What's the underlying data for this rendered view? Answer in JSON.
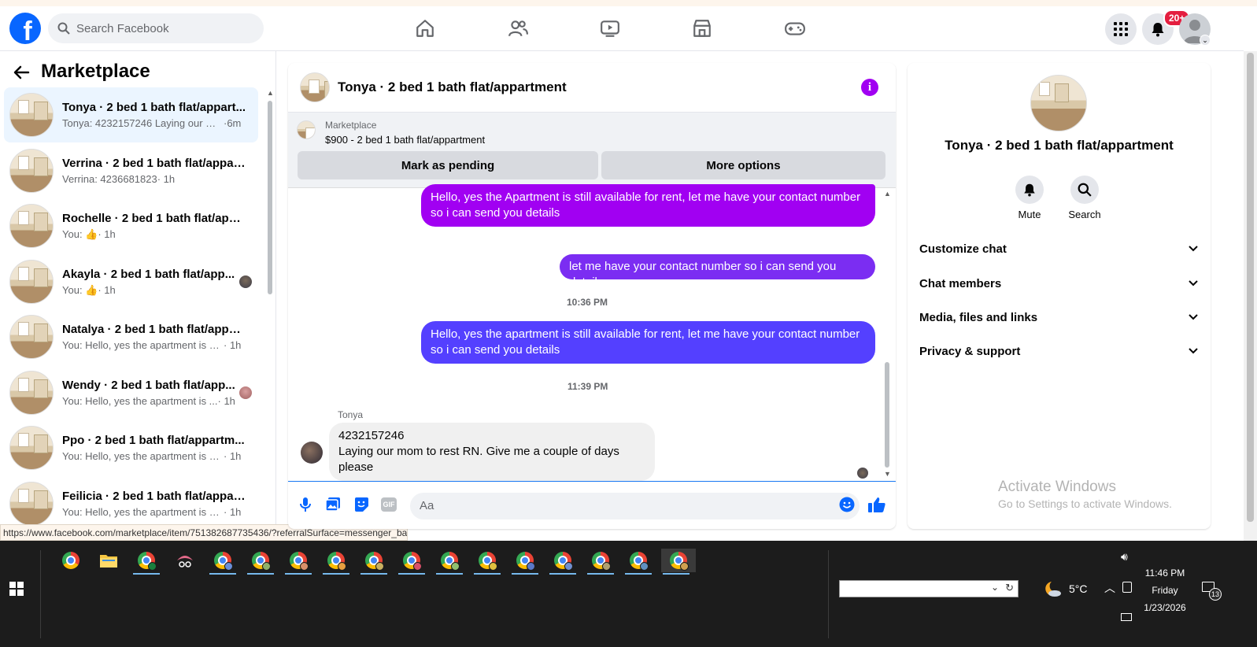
{
  "topbar": {
    "search_placeholder": "Search Facebook",
    "notifications_badge": "20+",
    "nav_icons": [
      "home-icon",
      "friends-icon",
      "watch-icon",
      "marketplace-icon",
      "gaming-icon"
    ]
  },
  "left_panel": {
    "title": "Marketplace",
    "conversations": [
      {
        "name": "Tonya · 2 bed 1 bath flat/appart...",
        "snippet": "Tonya: 4232157246 Laying our mo...",
        "time": " ·6m",
        "active": true
      },
      {
        "name": "Verrina · 2 bed 1 bath flat/appar...",
        "snippet": "Verrina: 4236681823",
        "time": " · 1h"
      },
      {
        "name": "Rochelle · 2 bed 1 bath flat/appa...",
        "snippet": "You: 👍",
        "time": " · 1h"
      },
      {
        "name": "Akayla · 2 bed 1 bath flat/app...",
        "snippet": "You: 👍",
        "time": " · 1h",
        "seen": true
      },
      {
        "name": "Natalya · 2 bed 1 bath flat/appar...",
        "snippet": "You: Hello, yes the apartment is still...",
        "time": " · 1h"
      },
      {
        "name": "Wendy · 2 bed 1 bath flat/app...",
        "snippet": "You: Hello, yes the apartment is ...",
        "time": " · 1h",
        "seen": true
      },
      {
        "name": "Ppo · 2 bed 1 bath flat/appartm...",
        "snippet": "You: Hello, yes the apartment is still...",
        "time": " · 1h"
      },
      {
        "name": "Feilicia · 2 bed 1 bath flat/appart...",
        "snippet": "You: Hello, yes the apartment is still...",
        "time": " · 1h"
      }
    ]
  },
  "status_url": "https://www.facebook.com/marketplace/item/751382687735436/?referralSurface=messenger_ba...",
  "chat": {
    "title": "Tonya · 2 bed 1 bath flat/appartment",
    "marketplace_label": "Marketplace",
    "listing": "$900 - 2 bed 1 bath flat/appartment",
    "mark_pending": "Mark as pending",
    "more_options": "More options",
    "messages": {
      "m1": "Hello, yes the Apartment is still available for rent, let me have your contact number so i can send you details",
      "m2": "let me have your contact number so i can send you details",
      "t1": "10:36 PM",
      "m3": "Hello, yes the apartment is still available for rent, let me have your contact number so i can send you details",
      "t2": "11:39 PM",
      "sender": "Tonya",
      "m4_line1": "4232157246",
      "m4_line2": "Laying our mom to rest RN. Give me a couple of days please"
    },
    "composer_placeholder": "Aa"
  },
  "right_panel": {
    "name": "Tonya · 2 bed 1 bath flat/appartment",
    "mute": "Mute",
    "search": "Search",
    "sections": [
      "Customize chat",
      "Chat members",
      "Media, files and links",
      "Privacy & support"
    ]
  },
  "activate": {
    "line1": "Activate Windows",
    "line2": "Go to Settings to activate Windows."
  },
  "taskbar": {
    "temperature": "5°C",
    "time": "11:46 PM",
    "day": "Friday",
    "date": "1/23/2026",
    "notif_count": "13"
  },
  "colors": {
    "brand": "#0866ff",
    "bubble_purple": "#a100f2",
    "bubble_violet": "#7b2df2",
    "bubble_blue": "#5440ff"
  }
}
